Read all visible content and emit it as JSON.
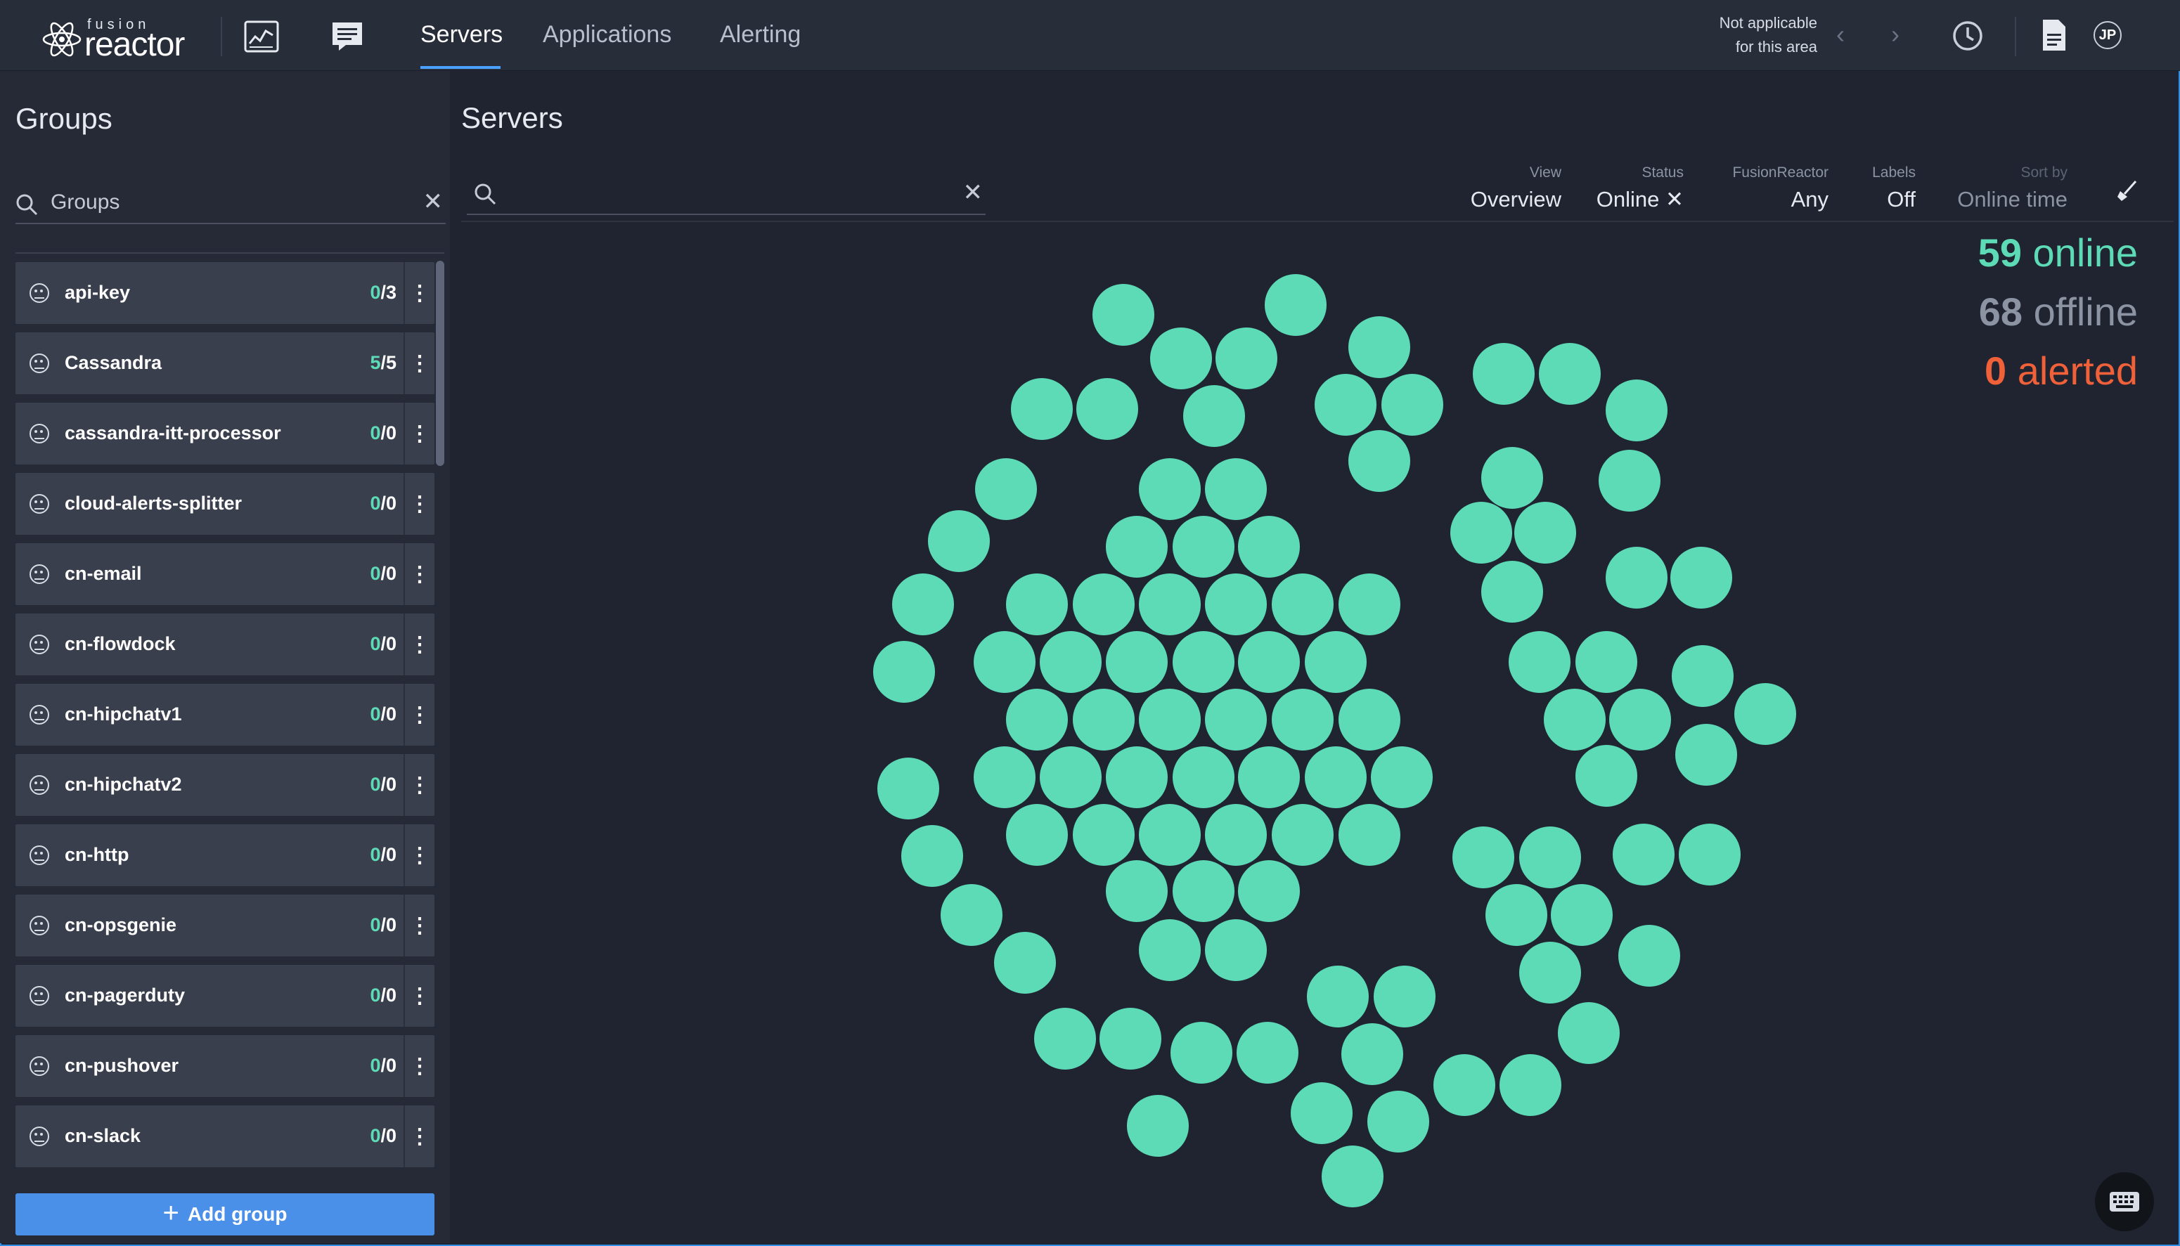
{
  "header": {
    "logo_top": "fusion",
    "logo_main": "reactor",
    "logo_tm": "™",
    "tabs": [
      {
        "label": "Servers",
        "active": true
      },
      {
        "label": "Applications",
        "active": false
      },
      {
        "label": "Alerting",
        "active": false
      }
    ],
    "time_line1": "Not applicable",
    "time_line2": "for this area",
    "avatar": "JP"
  },
  "sidebar": {
    "title": "Groups",
    "search_placeholder": "Groups",
    "groups": [
      {
        "name": "api-key",
        "online": "0",
        "total": "/3"
      },
      {
        "name": "Cassandra",
        "online": "5",
        "total": "/5"
      },
      {
        "name": "cassandra-itt-processor",
        "online": "0",
        "total": "/0"
      },
      {
        "name": "cloud-alerts-splitter",
        "online": "0",
        "total": "/0"
      },
      {
        "name": "cn-email",
        "online": "0",
        "total": "/0"
      },
      {
        "name": "cn-flowdock",
        "online": "0",
        "total": "/0"
      },
      {
        "name": "cn-hipchatv1",
        "online": "0",
        "total": "/0"
      },
      {
        "name": "cn-hipchatv2",
        "online": "0",
        "total": "/0"
      },
      {
        "name": "cn-http",
        "online": "0",
        "total": "/0"
      },
      {
        "name": "cn-opsgenie",
        "online": "0",
        "total": "/0"
      },
      {
        "name": "cn-pagerduty",
        "online": "0",
        "total": "/0"
      },
      {
        "name": "cn-pushover",
        "online": "0",
        "total": "/0"
      },
      {
        "name": "cn-slack",
        "online": "0",
        "total": "/0"
      }
    ],
    "add_group_label": "Add group"
  },
  "main": {
    "title": "Servers",
    "filters": {
      "view": {
        "label": "View",
        "value": "Overview"
      },
      "status": {
        "label": "Status",
        "value": "Online ✕"
      },
      "fusionreactor": {
        "label": "FusionReactor",
        "value": "Any"
      },
      "labels": {
        "label": "Labels",
        "value": "Off"
      },
      "sort": {
        "label": "Sort by",
        "value": "Online time"
      }
    },
    "stats": {
      "online_count": "59",
      "online_label": " online",
      "offline_count": "68",
      "offline_label": " offline",
      "alerted_count": "0",
      "alerted_label": " alerted"
    }
  },
  "colors": {
    "accent": "#4a8fe8",
    "online": "#5ddbb6",
    "offline": "#8c93a3",
    "alerted": "#f0613a",
    "background": "#1f2430"
  }
}
